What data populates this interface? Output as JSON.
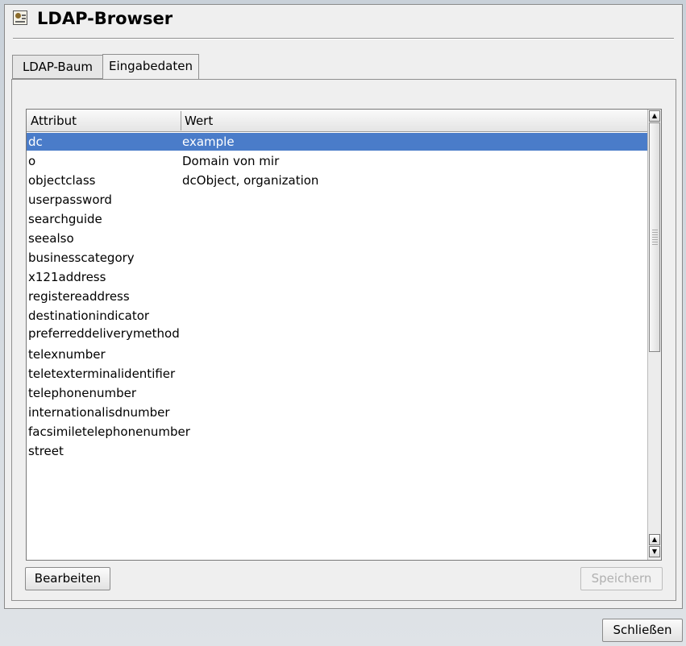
{
  "window": {
    "title": "LDAP-Browser",
    "icon": "address-book-icon"
  },
  "tabs": [
    {
      "label": "LDAP-Baum",
      "active": false
    },
    {
      "label": "Eingabedaten",
      "active": true
    }
  ],
  "table": {
    "columns": [
      "Attribut",
      "Wert"
    ],
    "rows": [
      {
        "attribute": "dc",
        "value": "example",
        "selected": true
      },
      {
        "attribute": "o",
        "value": "Domain von mir"
      },
      {
        "attribute": "objectclass",
        "value": "dcObject, organization"
      },
      {
        "attribute": "userpassword",
        "value": ""
      },
      {
        "attribute": "searchguide",
        "value": ""
      },
      {
        "attribute": "seealso",
        "value": ""
      },
      {
        "attribute": "businesscategory",
        "value": ""
      },
      {
        "attribute": "x121address",
        "value": ""
      },
      {
        "attribute": "registereaddress",
        "value": ""
      },
      {
        "attribute": "destinationindicator",
        "value": ""
      },
      {
        "attribute": "preferreddeliverymethod",
        "value": ""
      },
      {
        "attribute": "telexnumber",
        "value": ""
      },
      {
        "attribute": "teletexterminalidentifier",
        "value": ""
      },
      {
        "attribute": "telephonenumber",
        "value": ""
      },
      {
        "attribute": "internationalisdnumber",
        "value": ""
      },
      {
        "attribute": "facsimiletelephonenumber",
        "value": ""
      },
      {
        "attribute": "street",
        "value": ""
      }
    ]
  },
  "buttons": {
    "edit": "Bearbeiten",
    "save": "Speichern",
    "close": "Schließen"
  },
  "colors": {
    "selection": "#4a7cc9"
  }
}
